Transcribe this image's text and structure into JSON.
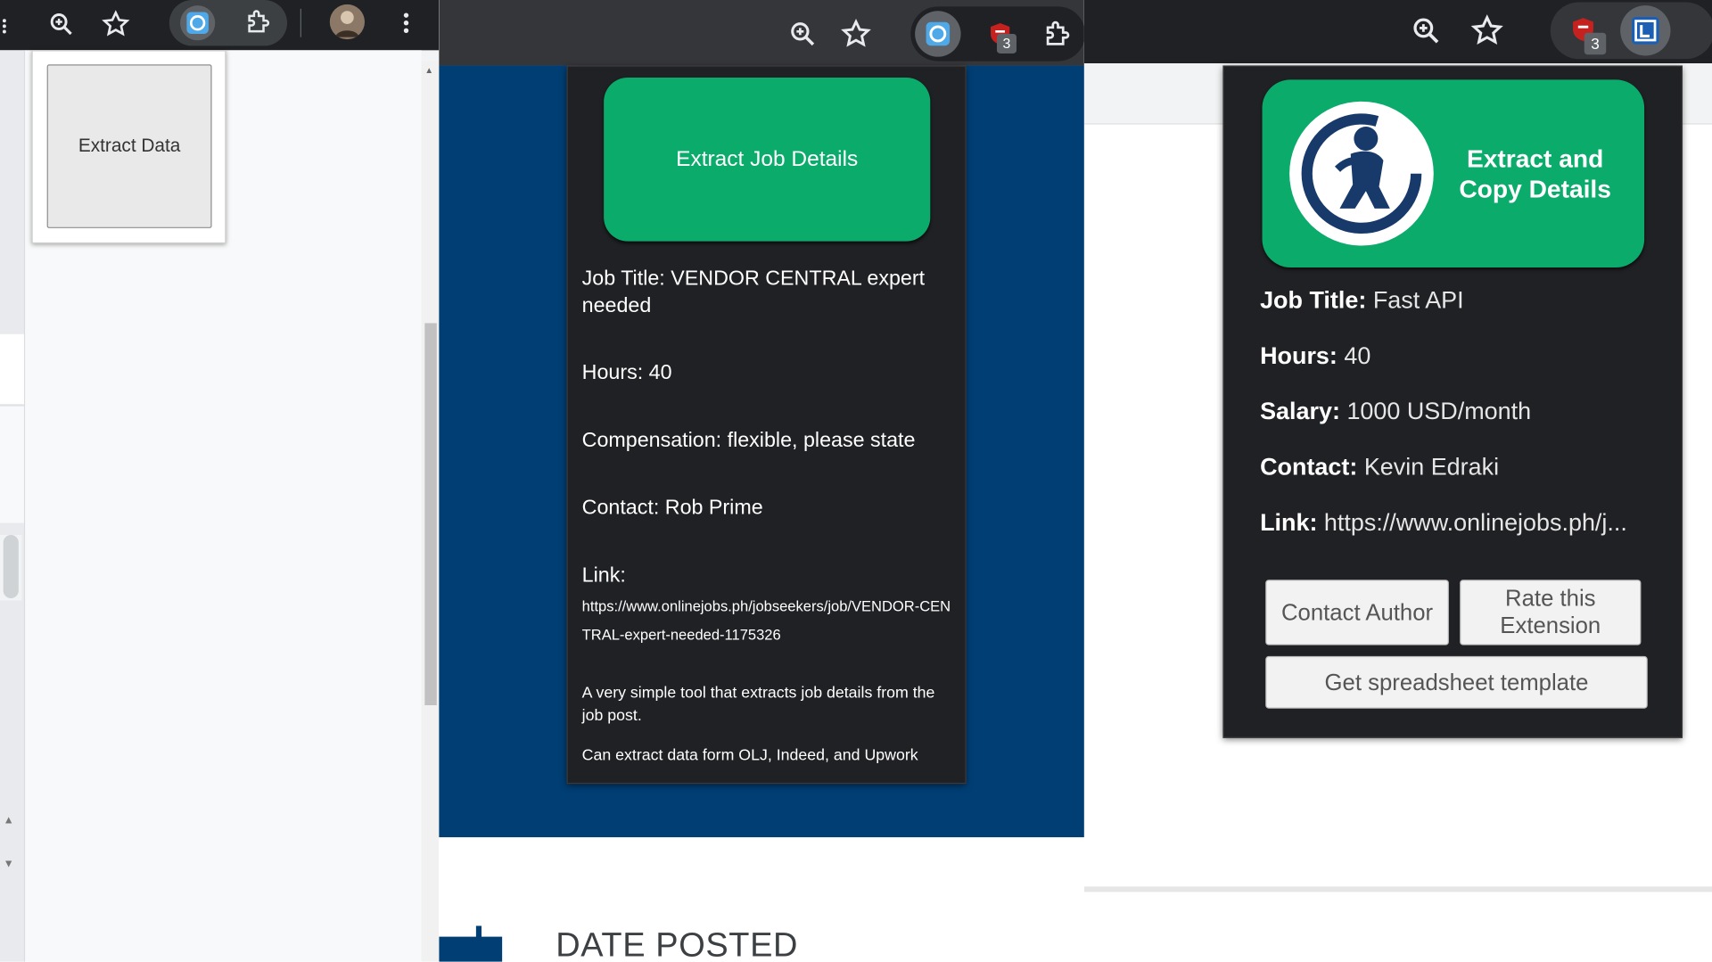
{
  "panel1": {
    "toolbar_icons": [
      "zoom-icon",
      "bookmark-star-icon",
      "extension-blue-icon",
      "puzzle-extensions-icon",
      "profile-avatar",
      "kebab-menu-icon"
    ],
    "popup": {
      "button_label": "Extract Data"
    }
  },
  "panel2": {
    "toolbar_icons": [
      "zoom-icon",
      "bookmark-star-icon",
      "extension-blue-icon",
      "extension-red-icon",
      "puzzle-extensions-icon"
    ],
    "badge_count": "3",
    "popup": {
      "button_label": "Extract Job Details",
      "job_title": "Job Title: VENDOR CENTRAL expert needed",
      "hours": "Hours: 40",
      "compensation": "Compensation: flexible, please state",
      "contact": "Contact: Rob Prime",
      "link_label": "Link:",
      "link_url": "https://www.onlinejobs.ph/jobseekers/job/VENDOR-CENTRAL-expert-needed-1175326",
      "description": "A very simple tool that extracts job details from the job post.",
      "sources": "Can extract data form OLJ, Indeed, and Upwork"
    },
    "page": {
      "date_posted": "DATE POSTED"
    },
    "colors": {
      "page_blue": "#003e74",
      "button_green": "#0bab6b"
    }
  },
  "panel3": {
    "toolbar_icons": [
      "zoom-icon",
      "bookmark-star-icon",
      "extension-red-icon",
      "extension-blue-icon"
    ],
    "badge_count": "3",
    "popup": {
      "button_label": "Extract and Copy Details",
      "job_title_label": "Job Title:",
      "job_title_value": "Fast API",
      "hours_label": "Hours:",
      "hours_value": "40",
      "salary_label": "Salary:",
      "salary_value": "1000 USD/month",
      "contact_label": "Contact:",
      "contact_value": "Kevin Edraki",
      "link_label": "Link:",
      "link_value": "https://www.onlinejobs.ph/j...",
      "contact_author": "Contact Author",
      "rate_extension": "Rate this Extension",
      "spreadsheet_template": "Get spreadsheet template"
    }
  }
}
